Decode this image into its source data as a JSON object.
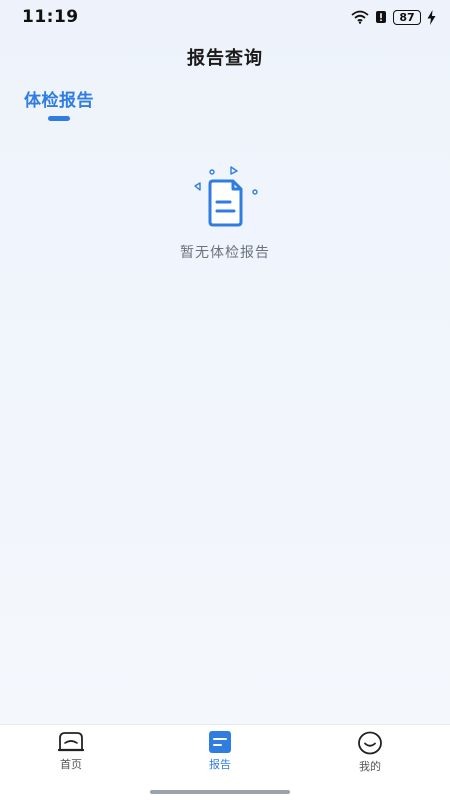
{
  "status_bar": {
    "time": "11:19",
    "battery": "87",
    "icons": [
      "wifi-icon",
      "alert-icon",
      "battery-icon",
      "charging-icon"
    ]
  },
  "header": {
    "title": "报告查询"
  },
  "tabs": [
    {
      "label": "体检报告",
      "active": true
    }
  ],
  "empty_state": {
    "message": "暂无体检报告",
    "icon": "document-icon"
  },
  "bottom_nav": {
    "items": [
      {
        "label": "首页",
        "icon": "home-icon",
        "active": false
      },
      {
        "label": "报告",
        "icon": "report-icon",
        "active": true
      },
      {
        "label": "我的",
        "icon": "smile-icon",
        "active": false
      }
    ]
  },
  "colors": {
    "accent": "#2f7de1",
    "background": "#f0f5fc",
    "text_muted": "#6b7280"
  }
}
